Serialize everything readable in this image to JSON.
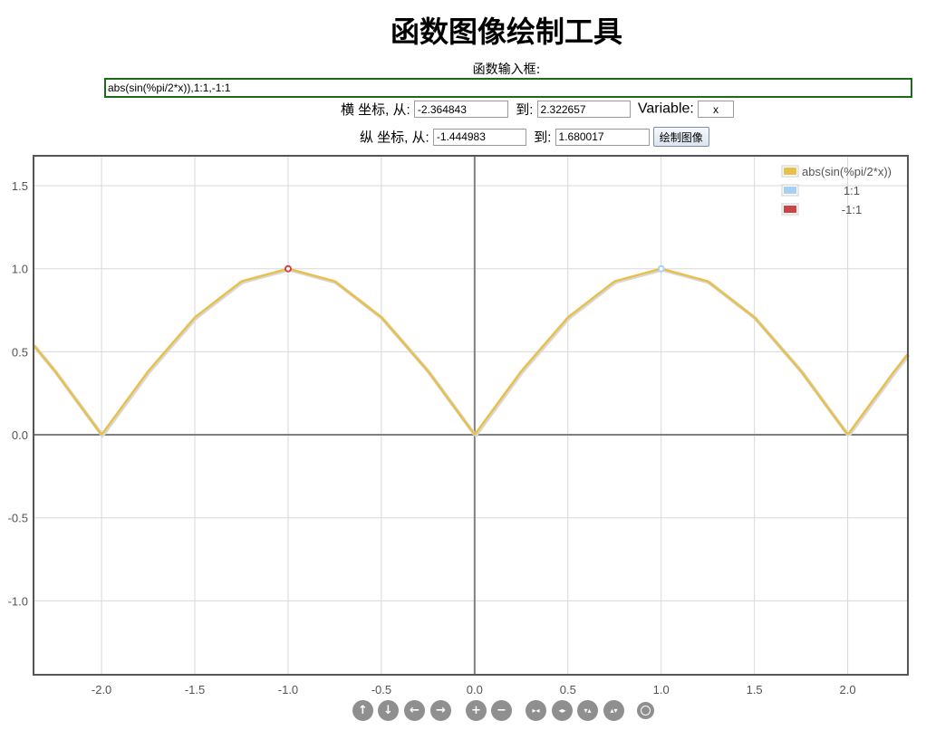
{
  "page": {
    "title": "函数图像绘制工具",
    "input_label": "函数输入框:",
    "function_value": "abs(sin(%pi/2*x)),1:1,-1:1"
  },
  "x_range": {
    "label": "横 坐标, 从:",
    "from": "-2.364843",
    "to_label": "到:",
    "to": "2.322657",
    "variable_label": "Variable:",
    "variable": "x"
  },
  "y_range": {
    "label": "纵 坐标, 从:",
    "from": "-1.444983",
    "to_label": "到:",
    "to": "1.680017",
    "draw_label": "绘制图像"
  },
  "nav_icons": [
    "pan-up-icon",
    "pan-down-icon",
    "pan-left-icon",
    "pan-right-icon",
    "zoom-in-icon",
    "zoom-out-icon",
    "shrink-x-icon",
    "expand-x-icon",
    "shrink-y-icon",
    "expand-y-icon",
    "reset-view-icon"
  ],
  "chart_data": {
    "type": "line",
    "title": "",
    "xlabel": "",
    "ylabel": "",
    "xlim": [
      -2.364843,
      2.322657
    ],
    "ylim": [
      -1.444983,
      1.680017
    ],
    "x_ticks": [
      "-2.0",
      "-1.5",
      "-1.0",
      "-0.5",
      "0.0",
      "0.5",
      "1.0",
      "1.5",
      "2.0"
    ],
    "x_tick_values": [
      -2.0,
      -1.5,
      -1.0,
      -0.5,
      0.0,
      0.5,
      1.0,
      1.5,
      2.0
    ],
    "y_ticks": [
      "1.5",
      "1.0",
      "0.5",
      "0.0",
      "-0.5",
      "-1.0"
    ],
    "y_tick_values": [
      1.5,
      1.0,
      0.5,
      0.0,
      -0.5,
      -1.0
    ],
    "grid": true,
    "legend_position": "top-right",
    "series": [
      {
        "name": "abs(sin(%pi/2*x))",
        "kind": "curve",
        "color": "#e8c04a",
        "x": [
          -2.364843,
          -2.25,
          -2.0,
          -1.75,
          -1.5,
          -1.25,
          -1.0,
          -0.75,
          -0.5,
          -0.25,
          0.0,
          0.25,
          0.5,
          0.75,
          1.0,
          1.25,
          1.5,
          1.75,
          2.0,
          2.25,
          2.322657
        ],
        "y": [
          0.54,
          0.383,
          0.0,
          0.383,
          0.707,
          0.924,
          1.0,
          0.924,
          0.707,
          0.383,
          0.0,
          0.383,
          0.707,
          0.924,
          1.0,
          0.924,
          0.707,
          0.383,
          0.0,
          0.383,
          0.487
        ]
      },
      {
        "name": "1:1",
        "kind": "point",
        "color": "#a8d0f0",
        "x": [
          1
        ],
        "y": [
          1
        ]
      },
      {
        "name": "-1:1",
        "kind": "point",
        "color": "#cc4444",
        "x": [
          -1
        ],
        "y": [
          1
        ]
      }
    ]
  }
}
